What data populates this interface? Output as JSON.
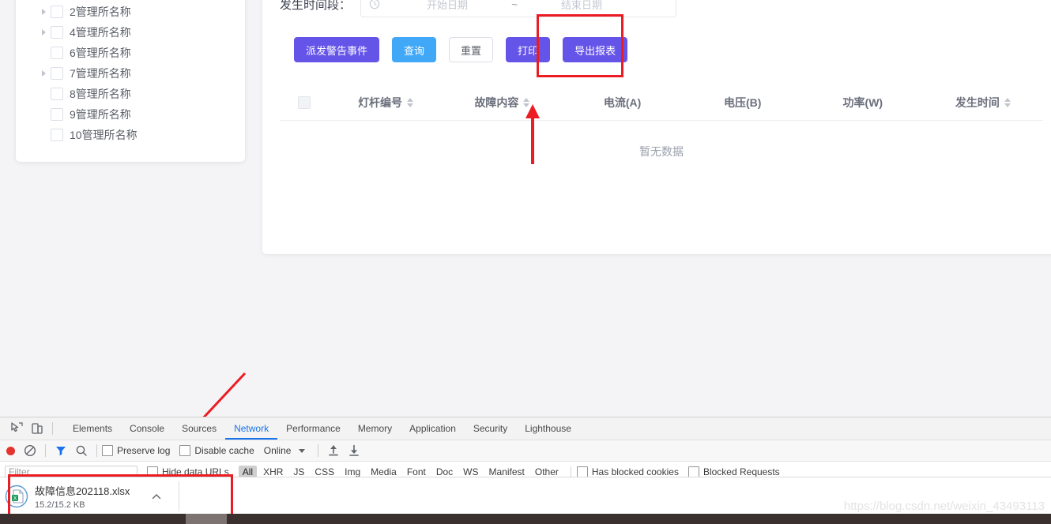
{
  "tree": {
    "items": [
      {
        "label": "2管理所名称",
        "expandable": true
      },
      {
        "label": "4管理所名称",
        "expandable": true
      },
      {
        "label": "6管理所名称",
        "expandable": false
      },
      {
        "label": "7管理所名称",
        "expandable": true
      },
      {
        "label": "8管理所名称",
        "expandable": false
      },
      {
        "label": "9管理所名称",
        "expandable": false
      },
      {
        "label": "10管理所名称",
        "expandable": false
      }
    ]
  },
  "filter": {
    "time_range_label": "发生时间段：",
    "start_placeholder": "开始日期",
    "separator": "~",
    "end_placeholder": "结束日期"
  },
  "buttons": {
    "dispatch": "派发警告事件",
    "query": "查询",
    "reset": "重置",
    "print": "打印",
    "export": "导出报表"
  },
  "table": {
    "columns": [
      {
        "label": "灯杆编号",
        "sortable": true
      },
      {
        "label": "故障内容",
        "sortable": true
      },
      {
        "label": "电流(A)",
        "sortable": false
      },
      {
        "label": "电压(B)",
        "sortable": false
      },
      {
        "label": "功率(W)",
        "sortable": false
      },
      {
        "label": "发生时间",
        "sortable": true
      }
    ],
    "empty_text": "暂无数据",
    "rows": []
  },
  "devtools": {
    "tabs": [
      {
        "label": "Elements",
        "active": false
      },
      {
        "label": "Console",
        "active": false
      },
      {
        "label": "Sources",
        "active": false
      },
      {
        "label": "Network",
        "active": true
      },
      {
        "label": "Performance",
        "active": false
      },
      {
        "label": "Memory",
        "active": false
      },
      {
        "label": "Application",
        "active": false
      },
      {
        "label": "Security",
        "active": false
      },
      {
        "label": "Lighthouse",
        "active": false
      }
    ],
    "toolbar": {
      "preserve_log": "Preserve log",
      "disable_cache": "Disable cache",
      "throttle": "Online"
    },
    "filterbar": {
      "filter_placeholder": "Filter",
      "hide_data_urls": "Hide data URLs",
      "types": [
        "All",
        "XHR",
        "JS",
        "CSS",
        "Img",
        "Media",
        "Font",
        "Doc",
        "WS",
        "Manifest",
        "Other"
      ],
      "selected_type": "All",
      "has_blocked_cookies": "Has blocked cookies",
      "blocked_requests": "Blocked Requests"
    }
  },
  "download": {
    "file_name": "故障信息202118.xlsx",
    "progress_text": "15.2/15.2 KB"
  },
  "watermark": "https://blog.csdn.net/weixin_43493113",
  "colors": {
    "primary_purple": "#6554e8",
    "query_blue": "#41a8f8",
    "annotation_red": "#ec1c24",
    "devtools_active_blue": "#1a73e8"
  }
}
